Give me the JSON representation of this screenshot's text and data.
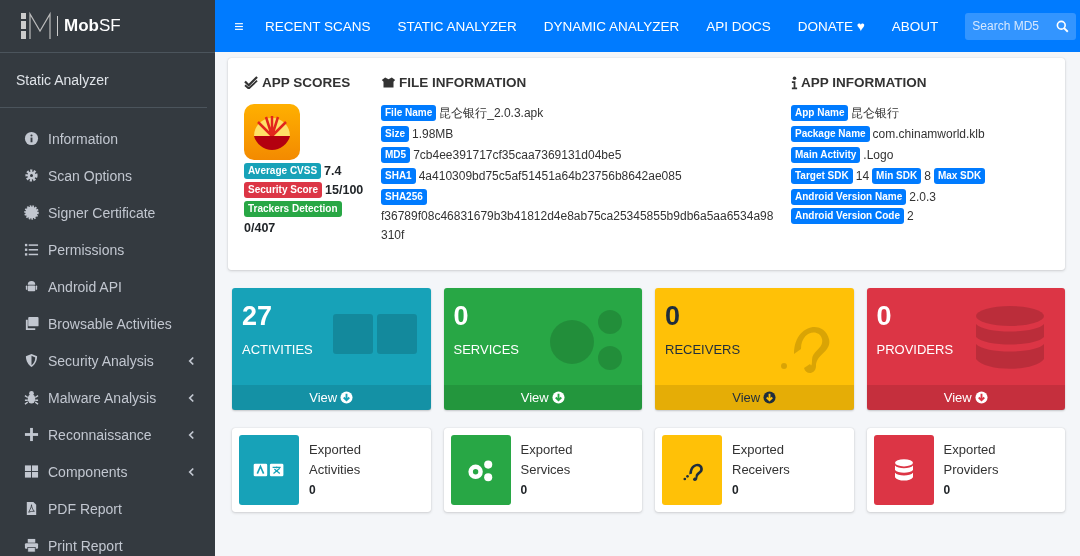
{
  "brand": {
    "name": "**Mob**SF"
  },
  "sidebar": {
    "section": "Static Analyzer",
    "items": [
      {
        "label": "Information",
        "kind": "info",
        "expandable": false
      },
      {
        "label": "Scan Options",
        "kind": "gear",
        "expandable": false
      },
      {
        "label": "Signer Certificate",
        "kind": "certificate",
        "expandable": false
      },
      {
        "label": "Permissions",
        "kind": "list",
        "expandable": false
      },
      {
        "label": "Android API",
        "kind": "android",
        "expandable": false
      },
      {
        "label": "Browsable Activities",
        "kind": "windows",
        "expandable": false
      },
      {
        "label": "Security Analysis",
        "kind": "shield",
        "expandable": true
      },
      {
        "label": "Malware Analysis",
        "kind": "bug",
        "expandable": true
      },
      {
        "label": "Reconnaissance",
        "kind": "plus",
        "expandable": true
      },
      {
        "label": "Components",
        "kind": "grid",
        "expandable": true
      },
      {
        "label": "PDF Report",
        "kind": "pdf",
        "expandable": false
      },
      {
        "label": "Print Report",
        "kind": "print",
        "expandable": false
      }
    ]
  },
  "navbar": {
    "items": [
      "RECENT SCANS",
      "STATIC ANALYZER",
      "DYNAMIC ANALYZER",
      "API DOCS",
      "DONATE ♥",
      "ABOUT"
    ],
    "search": {
      "placeholder": "Search MD5"
    }
  },
  "app_scores": {
    "title": "APP SCORES",
    "scores": [
      {
        "label": "Average CVSS",
        "value": "7.4",
        "color": "#17a2b8"
      },
      {
        "label": "Security Score",
        "value": "15/100",
        "color": "#dc3545"
      },
      {
        "label": "Trackers Detection",
        "value": "0/407",
        "color": "#28a745"
      }
    ]
  },
  "file_info": {
    "title": "FILE INFORMATION",
    "rows": [
      {
        "label": "File Name",
        "value": "昆仑银行_2.0.3.apk"
      },
      {
        "label": "Size",
        "value": "1.98MB"
      },
      {
        "label": "MD5",
        "value": "7cb4ee391717cf35caa7369131d04be5"
      },
      {
        "label": "SHA1",
        "value": "4a410309bd75c5af51451a64b23756b8642ae085"
      },
      {
        "label": "SHA256",
        "value": "f36789f08c46831679b3b41812d4e8ab75ca25345855b9db6a5aa6534a98310f"
      }
    ]
  },
  "app_info": {
    "title": "APP INFORMATION",
    "rows": [
      [
        {
          "label": "App Name",
          "value": "昆仑银行"
        }
      ],
      [
        {
          "label": "Package Name",
          "value": "com.chinamworld.klb"
        }
      ],
      [
        {
          "label": "Main Activity",
          "value": ".Logo"
        }
      ],
      [
        {
          "label": "Target SDK",
          "value": "14"
        },
        {
          "label": "Min SDK",
          "value": "8"
        },
        {
          "label": "Max SDK"
        }
      ],
      [
        {
          "label": "Android Version Name",
          "value": "2.0.3"
        },
        {
          "label": "Android Version Code",
          "value": "2"
        }
      ]
    ]
  },
  "components": [
    {
      "kind": "activities",
      "count": "27",
      "label": "ACTIVITIES",
      "color": "#17a2b8",
      "link": "View"
    },
    {
      "kind": "services",
      "count": "0",
      "label": "SERVICES",
      "color": "#28a745",
      "link": "View"
    },
    {
      "kind": "receivers",
      "count": "0",
      "label": "RECEIVERS",
      "color": "#ffc107",
      "link": "View"
    },
    {
      "kind": "providers",
      "count": "0",
      "label": "PROVIDERS",
      "color": "#dc3545",
      "link": "View"
    }
  ],
  "exported": [
    {
      "kind": "activities",
      "title": "Exported Activities",
      "count": "0",
      "color": "#17a2b8"
    },
    {
      "kind": "services",
      "title": "Exported Services",
      "count": "0",
      "color": "#28a745"
    },
    {
      "kind": "receivers",
      "title": "Exported Receivers",
      "count": "0",
      "color": "#ffc107"
    },
    {
      "kind": "providers",
      "title": "Exported Providers",
      "count": "0",
      "color": "#dc3545"
    }
  ]
}
